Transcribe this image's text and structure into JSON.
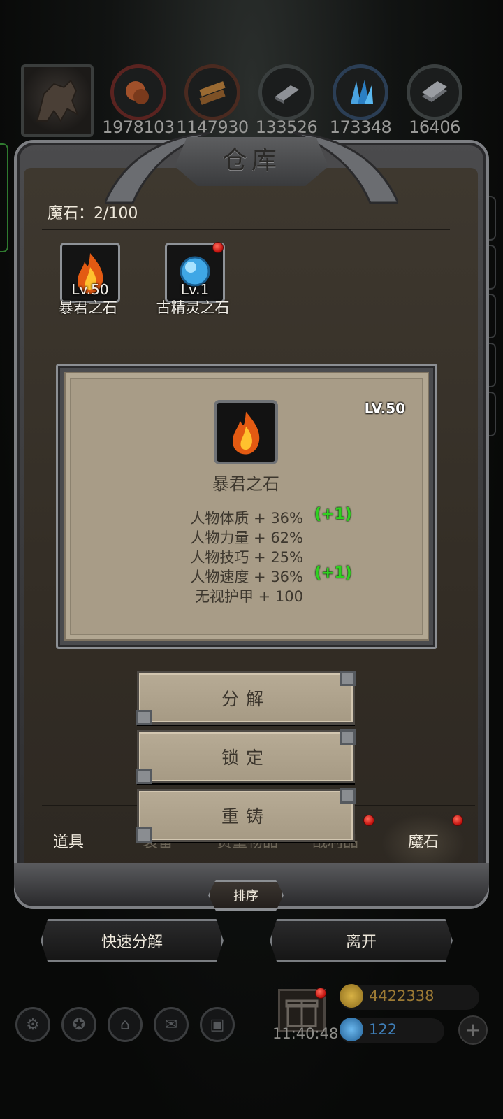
{
  "resources": [
    {
      "name": "avatar",
      "count": ""
    },
    {
      "name": "ore-icon",
      "count": "1978103"
    },
    {
      "name": "wood-icon",
      "count": "1147930"
    },
    {
      "name": "iron-icon",
      "count": "133526"
    },
    {
      "name": "crystal-icon",
      "count": "173348"
    },
    {
      "name": "metal-icon",
      "count": "16406"
    }
  ],
  "panel": {
    "title": "仓库",
    "category_label": "魔石：2/100"
  },
  "items": [
    {
      "level": "Lv.50",
      "name": "暴君之石",
      "badge": false
    },
    {
      "level": "Lv.1",
      "name": "古精灵之石",
      "badge": true
    }
  ],
  "detail": {
    "level": "LV.50",
    "name": "暴君之石",
    "stats": [
      {
        "text": "人物体质 + 36%",
        "bonus": "(+1)"
      },
      {
        "text": "人物力量 + 62%",
        "bonus": ""
      },
      {
        "text": "人物技巧 + 25%",
        "bonus": ""
      },
      {
        "text": "人物速度 + 36%",
        "bonus": "(+1)"
      },
      {
        "text": "无视护甲 + 100",
        "bonus": ""
      }
    ]
  },
  "actions": {
    "decompose": "分解",
    "lock": "锁定",
    "recast": "重铸"
  },
  "tabs": {
    "items": "道具",
    "equipment": "装备",
    "valuables": "贵重物品",
    "consumables": "战利品",
    "magic_stones": "魔石",
    "active": "magic_stones"
  },
  "buttons": {
    "sort": "排序",
    "quick_decompose": "快速分解",
    "leave": "离开"
  },
  "hud": {
    "timer": "11:40:48",
    "gold": "4422338",
    "gems": "122",
    "plus": "+"
  },
  "colors": {
    "bonus_green": "#2fd11f",
    "gold_text": "#9c7a34",
    "gem_text": "#3f7fb8",
    "badge_red": "#d4140f"
  }
}
